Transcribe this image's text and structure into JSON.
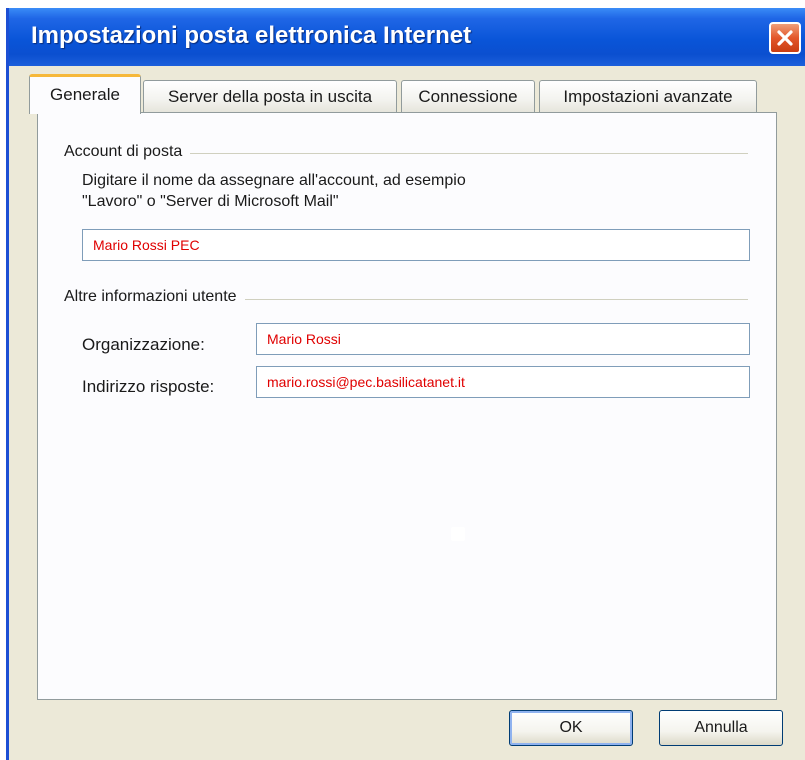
{
  "window": {
    "title": "Impostazioni posta elettronica Internet",
    "accent": "#0a55d8",
    "close_icon": "close-icon"
  },
  "tabs": [
    {
      "label": "Generale",
      "active": true
    },
    {
      "label": "Server della posta in uscita",
      "active": false
    },
    {
      "label": "Connessione",
      "active": false
    },
    {
      "label": "Impostazioni avanzate",
      "active": false
    }
  ],
  "account": {
    "group_label": "Account di posta",
    "desc_line1": "Digitare il nome da assegnare all'account, ad esempio",
    "desc_line2": "\"Lavoro\" o \"Server di Microsoft Mail\"",
    "name_value": "Mario Rossi PEC"
  },
  "user_info": {
    "group_label": "Altre informazioni utente",
    "org_label": "Organizzazione:",
    "org_value": "Mario Rossi",
    "reply_label": "Indirizzo risposte:",
    "reply_value": "mario.rossi@pec.basilicatanet.it"
  },
  "buttons": {
    "ok": "OK",
    "cancel": "Annulla"
  },
  "colors": {
    "input_text": "#e00000",
    "dialog_bg": "#ece9d8"
  }
}
